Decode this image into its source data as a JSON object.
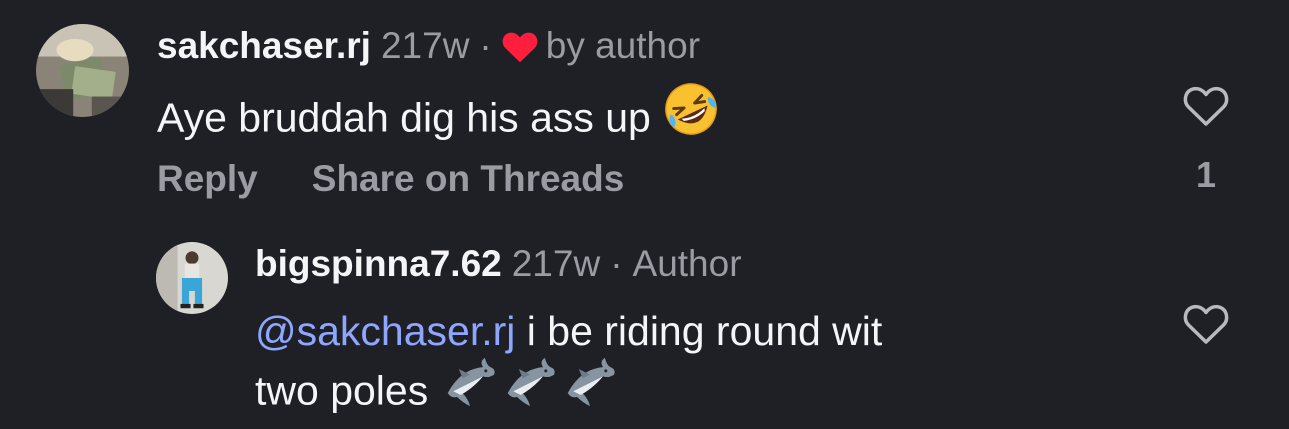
{
  "comments": [
    {
      "username": "sakchaser.rj",
      "age": "217w",
      "separator": "·",
      "liked_by_author_label": "by author",
      "text": "Aye bruddah dig his ass up",
      "emoji": "rolling-on-floor-laughing",
      "actions": {
        "reply": "Reply",
        "share": "Share on Threads"
      },
      "like_count": "1"
    },
    {
      "username": "bigspinna7.62",
      "age": "217w",
      "separator": "·",
      "author_label": "Author",
      "mention": "@sakchaser.rj",
      "text_line1": " i be riding round wit",
      "text_line2": "two poles",
      "emojis": [
        "shark",
        "shark",
        "shark"
      ]
    }
  ],
  "icons": {
    "like": "heart-outline-icon",
    "author_like": "heart-filled-icon"
  },
  "colors": {
    "background": "#1f2026",
    "primary_text": "#f5f5f7",
    "secondary_text": "#9a9ba3",
    "mention": "#8fa6ff",
    "heart_red": "#ff1f3d"
  }
}
